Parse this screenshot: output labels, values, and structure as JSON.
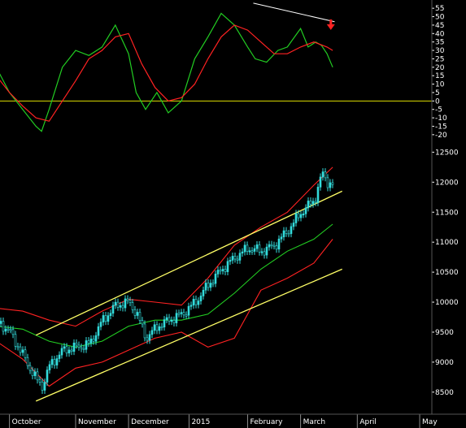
{
  "colors": {
    "background": "#000000",
    "axis_text": "#ffffff",
    "oscillator_fast": "#22cc22",
    "oscillator_slow": "#ff2222",
    "zero_line": "#dddd00",
    "candle_up": "#33dddd",
    "bollinger": "#ff2222",
    "moving_average": "#22cc22",
    "channel": "#ffff66",
    "divergence_line": "#ffffff",
    "arrow": "#ff2222"
  },
  "icons": {
    "signal_arrow": "red-down-arrow-icon"
  },
  "chart_data": [
    {
      "type": "line",
      "panel": "oscillator",
      "ylim": [
        -22,
        57
      ],
      "yticks": [
        "55",
        "50",
        "45",
        "40",
        "35",
        "30",
        "25",
        "20",
        "15",
        "10",
        "5",
        "0",
        "-5",
        "-10",
        "-15",
        "-20"
      ],
      "reference_line": 0,
      "divergence_line": {
        "x": [
          "2015-02-05",
          "2015-03-20"
        ],
        "y": [
          58,
          47
        ]
      },
      "signal_arrow": {
        "x": "2015-03-18",
        "y": 33,
        "direction": "down"
      },
      "series": [
        {
          "color": "#22cc22",
          "x": [
            "2014-09-22",
            "2014-09-29",
            "2014-10-06",
            "2014-10-13",
            "2014-10-16",
            "2014-10-20",
            "2014-10-27",
            "2014-11-03",
            "2014-11-10",
            "2014-11-17",
            "2014-11-24",
            "2014-12-01",
            "2014-12-05",
            "2014-12-10",
            "2014-12-16",
            "2014-12-22",
            "2014-12-29",
            "2015-01-05",
            "2015-01-12",
            "2015-01-19",
            "2015-01-26",
            "2015-02-02",
            "2015-02-06",
            "2015-02-12",
            "2015-02-18",
            "2015-02-23",
            "2015-03-02",
            "2015-03-06",
            "2015-03-10",
            "2015-03-13",
            "2015-03-16",
            "2015-03-19"
          ],
          "values": [
            20,
            5,
            -5,
            -15,
            -18,
            -5,
            20,
            30,
            27,
            32,
            45,
            28,
            5,
            -5,
            5,
            -7,
            0,
            25,
            38,
            52,
            45,
            32,
            25,
            23,
            30,
            32,
            43,
            32,
            35,
            33,
            28,
            20
          ]
        },
        {
          "color": "#ff2222",
          "x": [
            "2014-09-22",
            "2014-09-29",
            "2014-10-06",
            "2014-10-13",
            "2014-10-20",
            "2014-10-27",
            "2014-11-03",
            "2014-11-10",
            "2014-11-17",
            "2014-11-24",
            "2014-12-01",
            "2014-12-08",
            "2014-12-15",
            "2014-12-22",
            "2014-12-29",
            "2015-01-05",
            "2015-01-12",
            "2015-01-19",
            "2015-01-26",
            "2015-02-02",
            "2015-02-09",
            "2015-02-16",
            "2015-02-23",
            "2015-03-02",
            "2015-03-09",
            "2015-03-16",
            "2015-03-19"
          ],
          "values": [
            15,
            5,
            -3,
            -10,
            -12,
            0,
            12,
            25,
            30,
            38,
            40,
            22,
            8,
            0,
            2,
            10,
            25,
            38,
            45,
            42,
            35,
            28,
            28,
            32,
            35,
            32,
            30
          ]
        }
      ]
    },
    {
      "type": "candlestick",
      "panel": "price",
      "ylim": [
        8200,
        12600
      ],
      "yticks": [
        "12500",
        "12000",
        "11500",
        "11000",
        "10500",
        "10000",
        "9500",
        "9000",
        "8500"
      ],
      "xlabels": [
        "October",
        "November",
        "December",
        "2015",
        "February",
        "March",
        "April",
        "May"
      ],
      "xlabel_dates": [
        "2014-09-29",
        "2014-11-03",
        "2014-12-01",
        "2015-01-02",
        "2015-02-02",
        "2015-03-02",
        "2015-04-01",
        "2015-05-04"
      ],
      "xlim": [
        "2014-09-24",
        "2015-05-10"
      ],
      "close": {
        "x": [
          "2014-09-22",
          "2014-09-29",
          "2014-10-06",
          "2014-10-13",
          "2014-10-16",
          "2014-10-20",
          "2014-10-27",
          "2014-11-03",
          "2014-11-10",
          "2014-11-17",
          "2014-11-24",
          "2014-12-01",
          "2014-12-05",
          "2014-12-10",
          "2014-12-16",
          "2014-12-22",
          "2014-12-29",
          "2015-01-05",
          "2015-01-12",
          "2015-01-19",
          "2015-01-26",
          "2015-02-02",
          "2015-02-09",
          "2015-02-16",
          "2015-02-23",
          "2015-03-02",
          "2015-03-09",
          "2015-03-13",
          "2015-03-16",
          "2015-03-19"
        ],
        "values": [
          9700,
          9500,
          9100,
          8700,
          8600,
          8950,
          9200,
          9250,
          9300,
          9700,
          9950,
          10000,
          9800,
          9400,
          9600,
          9700,
          9800,
          10000,
          10300,
          10550,
          10750,
          10900,
          10850,
          10950,
          11200,
          11500,
          11700,
          12150,
          12000,
          11950
        ]
      },
      "overlays": [
        {
          "kind": "bollinger_upper",
          "color": "#ff2222",
          "x": [
            "2014-09-22",
            "2014-10-06",
            "2014-10-20",
            "2014-11-03",
            "2014-11-17",
            "2014-12-01",
            "2014-12-15",
            "2014-12-29",
            "2015-01-12",
            "2015-01-26",
            "2015-02-09",
            "2015-02-23",
            "2015-03-09",
            "2015-03-19"
          ],
          "values": [
            9900,
            9850,
            9700,
            9600,
            9850,
            10050,
            10000,
            9950,
            10400,
            10950,
            11250,
            11500,
            11950,
            12250
          ]
        },
        {
          "kind": "moving_average",
          "color": "#22cc22",
          "x": [
            "2014-09-22",
            "2014-10-06",
            "2014-10-20",
            "2014-11-03",
            "2014-11-17",
            "2014-12-01",
            "2014-12-15",
            "2014-12-29",
            "2015-01-12",
            "2015-01-26",
            "2015-02-09",
            "2015-02-23",
            "2015-03-09",
            "2015-03-19"
          ],
          "values": [
            9600,
            9550,
            9350,
            9250,
            9350,
            9600,
            9700,
            9700,
            9800,
            10150,
            10550,
            10850,
            11050,
            11300
          ]
        },
        {
          "kind": "bollinger_lower",
          "color": "#ff2222",
          "x": [
            "2014-09-22",
            "2014-10-06",
            "2014-10-20",
            "2014-11-03",
            "2014-11-17",
            "2014-12-01",
            "2014-12-15",
            "2014-12-29",
            "2015-01-12",
            "2015-01-26",
            "2015-02-09",
            "2015-02-23",
            "2015-03-09",
            "2015-03-19"
          ],
          "values": [
            9350,
            9050,
            8600,
            8900,
            9000,
            9200,
            9400,
            9500,
            9250,
            9400,
            10200,
            10400,
            10650,
            11050
          ]
        },
        {
          "kind": "channel_upper",
          "color": "#ffff66",
          "x": [
            "2014-10-13",
            "2015-03-24"
          ],
          "values": [
            9450,
            11850
          ]
        },
        {
          "kind": "channel_lower",
          "color": "#ffff66",
          "x": [
            "2014-10-13",
            "2015-03-24"
          ],
          "values": [
            8350,
            10550
          ]
        }
      ]
    }
  ]
}
